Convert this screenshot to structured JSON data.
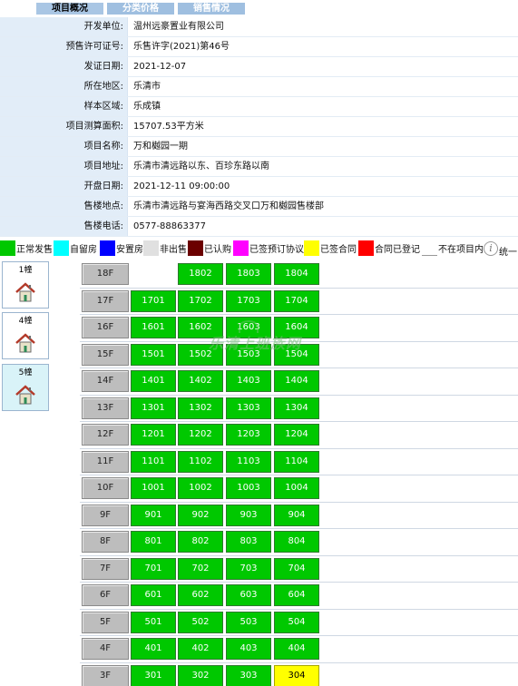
{
  "tabs": [
    {
      "label": "项目概况"
    },
    {
      "label": "分类价格"
    },
    {
      "label": "销售情况"
    }
  ],
  "info": [
    {
      "label": "开发单位:",
      "value": "温州远豪置业有限公司"
    },
    {
      "label": "预售许可证号:",
      "value": "乐售许字(2021)第46号"
    },
    {
      "label": "发证日期:",
      "value": "2021-12-07"
    },
    {
      "label": "所在地区:",
      "value": "乐清市"
    },
    {
      "label": "样本区域:",
      "value": "乐成镇"
    },
    {
      "label": "项目测算面积:",
      "value": "15707.53平方米"
    },
    {
      "label": "项目名称:",
      "value": "万和樾园一期"
    },
    {
      "label": "项目地址:",
      "value": "乐清市清远路以东、百珍东路以南"
    },
    {
      "label": "开盘日期:",
      "value": "2021-12-11 09:00:00"
    },
    {
      "label": "售楼地点:",
      "value": "乐清市清远路与宴海西路交叉口万和樾园售楼部"
    },
    {
      "label": "售楼电话:",
      "value": "0577-88863377"
    }
  ],
  "legend": [
    {
      "label": "正常发售",
      "color": "#00c800"
    },
    {
      "label": "自留房",
      "color": "#00ffff"
    },
    {
      "label": "安置房",
      "color": "#0000ff"
    },
    {
      "label": "非出售",
      "color": "#e0e0e0"
    },
    {
      "label": "已认购",
      "color": "#6b0000"
    },
    {
      "label": "已签预订协议",
      "color": "#ff00ff"
    },
    {
      "label": "已签合同",
      "color": "#ffff00"
    },
    {
      "label": "合同已登记",
      "color": "#ff0000"
    },
    {
      "label": "不在项目内",
      "color": "#ffffff"
    }
  ],
  "legend_tail": "统一",
  "buildings": [
    {
      "label": "1幢",
      "icon": "house-icon"
    },
    {
      "label": "4幢",
      "icon": "house-icon"
    },
    {
      "label": "5幢",
      "icon": "house-icon"
    }
  ],
  "watermark": "乐清上班族网",
  "floors": [
    {
      "label": "18F",
      "units": [
        {
          "no": "1802",
          "status": "normal"
        },
        {
          "no": "1803",
          "status": "normal"
        },
        {
          "no": "1804",
          "status": "normal"
        }
      ]
    },
    {
      "label": "17F",
      "units": [
        {
          "no": "1701",
          "status": "normal"
        },
        {
          "no": "1702",
          "status": "normal"
        },
        {
          "no": "1703",
          "status": "normal"
        },
        {
          "no": "1704",
          "status": "normal"
        }
      ]
    },
    {
      "label": "16F",
      "units": [
        {
          "no": "1601",
          "status": "normal"
        },
        {
          "no": "1602",
          "status": "normal"
        },
        {
          "no": "1603",
          "status": "normal"
        },
        {
          "no": "1604",
          "status": "normal"
        }
      ]
    },
    {
      "label": "15F",
      "units": [
        {
          "no": "1501",
          "status": "normal"
        },
        {
          "no": "1502",
          "status": "normal"
        },
        {
          "no": "1503",
          "status": "normal"
        },
        {
          "no": "1504",
          "status": "normal"
        }
      ]
    },
    {
      "label": "14F",
      "units": [
        {
          "no": "1401",
          "status": "normal"
        },
        {
          "no": "1402",
          "status": "normal"
        },
        {
          "no": "1403",
          "status": "normal"
        },
        {
          "no": "1404",
          "status": "normal"
        }
      ]
    },
    {
      "label": "13F",
      "units": [
        {
          "no": "1301",
          "status": "normal"
        },
        {
          "no": "1302",
          "status": "normal"
        },
        {
          "no": "1303",
          "status": "normal"
        },
        {
          "no": "1304",
          "status": "normal"
        }
      ]
    },
    {
      "label": "12F",
      "units": [
        {
          "no": "1201",
          "status": "normal"
        },
        {
          "no": "1202",
          "status": "normal"
        },
        {
          "no": "1203",
          "status": "normal"
        },
        {
          "no": "1204",
          "status": "normal"
        }
      ]
    },
    {
      "label": "11F",
      "units": [
        {
          "no": "1101",
          "status": "normal"
        },
        {
          "no": "1102",
          "status": "normal"
        },
        {
          "no": "1103",
          "status": "normal"
        },
        {
          "no": "1104",
          "status": "normal"
        }
      ]
    },
    {
      "label": "10F",
      "units": [
        {
          "no": "1001",
          "status": "normal"
        },
        {
          "no": "1002",
          "status": "normal"
        },
        {
          "no": "1003",
          "status": "normal"
        },
        {
          "no": "1004",
          "status": "normal"
        }
      ]
    },
    {
      "label": "9F",
      "units": [
        {
          "no": "901",
          "status": "normal"
        },
        {
          "no": "902",
          "status": "normal"
        },
        {
          "no": "903",
          "status": "normal"
        },
        {
          "no": "904",
          "status": "normal"
        }
      ]
    },
    {
      "label": "8F",
      "units": [
        {
          "no": "801",
          "status": "normal"
        },
        {
          "no": "802",
          "status": "normal"
        },
        {
          "no": "803",
          "status": "normal"
        },
        {
          "no": "804",
          "status": "normal"
        }
      ]
    },
    {
      "label": "7F",
      "units": [
        {
          "no": "701",
          "status": "normal"
        },
        {
          "no": "702",
          "status": "normal"
        },
        {
          "no": "703",
          "status": "normal"
        },
        {
          "no": "704",
          "status": "normal"
        }
      ]
    },
    {
      "label": "6F",
      "units": [
        {
          "no": "601",
          "status": "normal"
        },
        {
          "no": "602",
          "status": "normal"
        },
        {
          "no": "603",
          "status": "normal"
        },
        {
          "no": "604",
          "status": "normal"
        }
      ]
    },
    {
      "label": "5F",
      "units": [
        {
          "no": "501",
          "status": "normal"
        },
        {
          "no": "502",
          "status": "normal"
        },
        {
          "no": "503",
          "status": "normal"
        },
        {
          "no": "504",
          "status": "normal"
        }
      ]
    },
    {
      "label": "4F",
      "units": [
        {
          "no": "401",
          "status": "normal"
        },
        {
          "no": "402",
          "status": "normal"
        },
        {
          "no": "403",
          "status": "normal"
        },
        {
          "no": "404",
          "status": "normal"
        }
      ]
    },
    {
      "label": "3F",
      "units": [
        {
          "no": "301",
          "status": "normal"
        },
        {
          "no": "302",
          "status": "normal"
        },
        {
          "no": "303",
          "status": "normal"
        },
        {
          "no": "304",
          "status": "contract"
        }
      ]
    }
  ]
}
